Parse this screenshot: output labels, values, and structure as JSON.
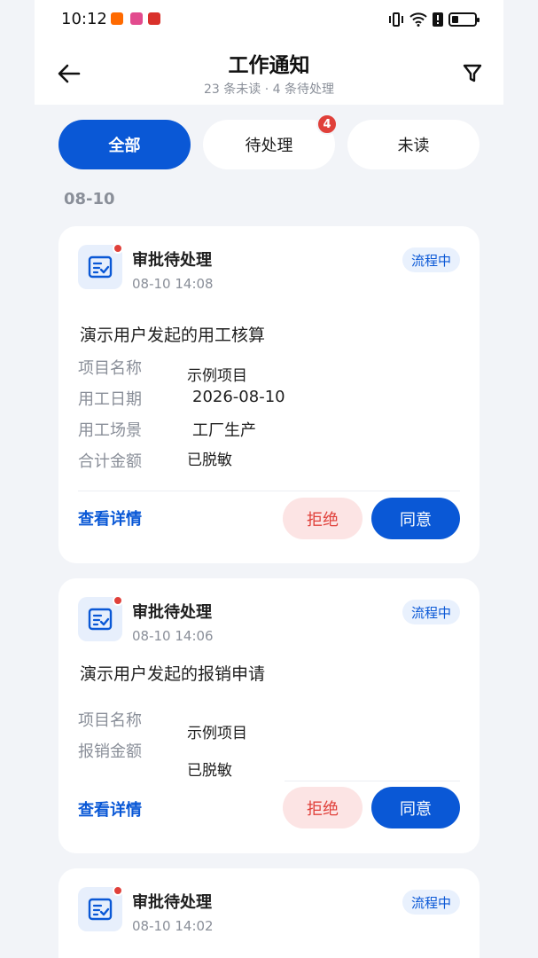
{
  "status_bar": {
    "time": "10:12"
  },
  "header": {
    "title": "工作通知",
    "subtitle": "23 条未读 · 4 条待处理"
  },
  "tabs": [
    {
      "label": "全部",
      "active": true
    },
    {
      "label": "待处理",
      "badge": "4"
    },
    {
      "label": "未读"
    }
  ],
  "date_group": "08-10",
  "cards": [
    {
      "title": "审批待处理",
      "time": "08-10 14:08",
      "status": "流程中",
      "subject": "演示用户发起的用工核算",
      "fields": [
        {
          "label": "项目名称",
          "value": "示例项目"
        },
        {
          "label": "用工日期",
          "value": "2026-08-10"
        },
        {
          "label": "用工场景",
          "value": "工厂生产"
        },
        {
          "label": "合计金额",
          "value": "已脱敏"
        }
      ],
      "detail_label": "查看详情",
      "reject_label": "拒绝",
      "agree_label": "同意"
    },
    {
      "title": "审批待处理",
      "time": "08-10 14:06",
      "status": "流程中",
      "subject": "演示用户发起的报销申请",
      "fields": [
        {
          "label": "项目名称",
          "value": "示例项目"
        },
        {
          "label": "报销金额",
          "value": "已脱敏"
        }
      ],
      "detail_label": "查看详情",
      "reject_label": "拒绝",
      "agree_label": "同意"
    },
    {
      "title": "审批待处理",
      "time": "08-10 14:02",
      "status": "流程中"
    }
  ],
  "colors": {
    "primary": "#0A58D6",
    "danger": "#E0403A",
    "background": "#F2F4F8"
  },
  "icons": [
    "back-arrow-icon",
    "filter-icon",
    "approval-checklist-icon"
  ]
}
